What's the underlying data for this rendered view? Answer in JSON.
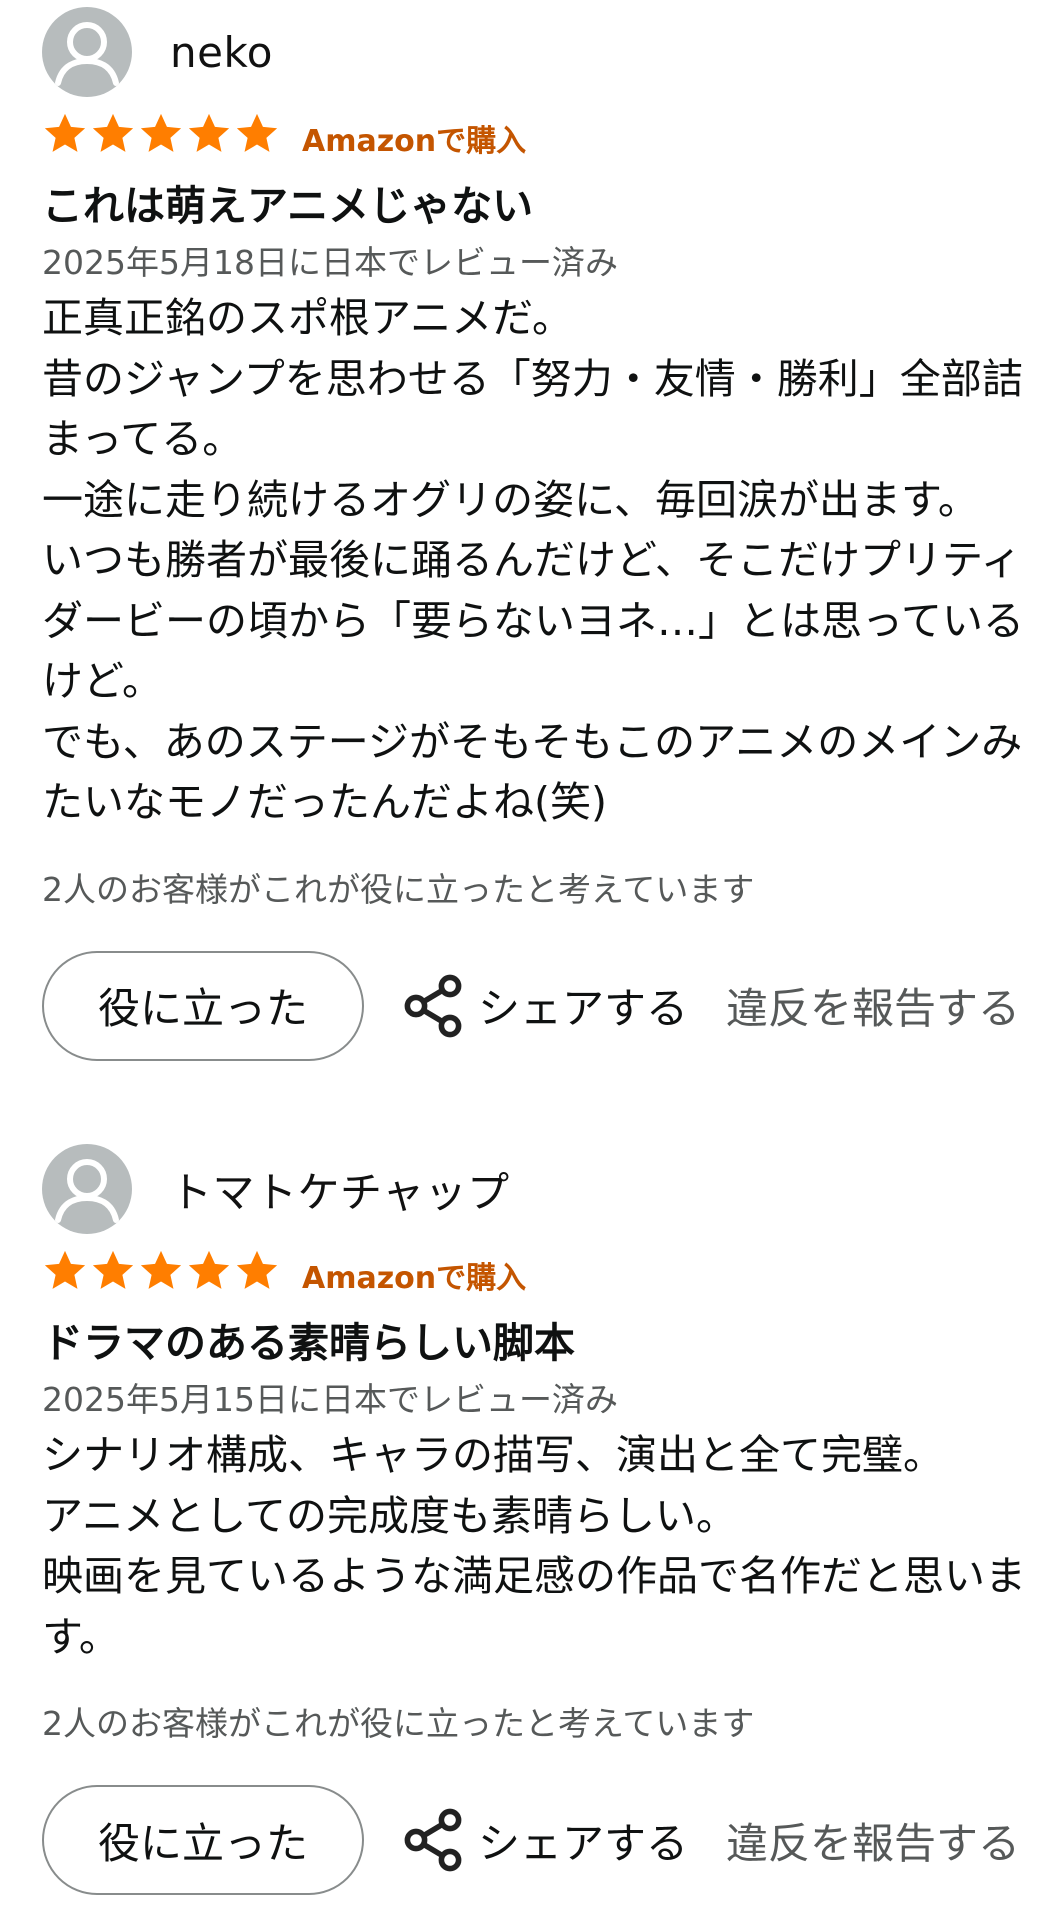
{
  "reviews": [
    {
      "author": "neko",
      "rating": 5,
      "verified": "Amazonで購入",
      "title": "これは萌えアニメじゃない",
      "date": "2025年5月18日に日本でレビュー済み",
      "body": "正真正銘のスポ根アニメだ。\n昔のジャンプを思わせる「努力・友情・勝利」全部詰まってる。\n一途に走り続けるオグリの姿に、毎回涙が出ます。\nいつも勝者が最後に踊るんだけど、そこだけプリティダービーの頃から「要らないヨネ…」とは思っているけど。\nでも、あのステージがそもそもこのアニメのメインみたいなモノだったんだよね(笑)",
      "helpful_count": "2人のお客様がこれが役に立ったと考えています",
      "helpful_label": "役に立った",
      "share_label": "シェアする",
      "report_label": "違反を報告する"
    },
    {
      "author": "トマトケチャップ",
      "rating": 5,
      "verified": "Amazonで購入",
      "title": "ドラマのある素晴らしい脚本",
      "date": "2025年5月15日に日本でレビュー済み",
      "body": "シナリオ構成、キャラの描写、演出と全て完璧。\nアニメとしての完成度も素晴らしい。\n映画を見ているような満足感の作品で名作だと思います。",
      "helpful_count": "2人のお客様がこれが役に立ったと考えています",
      "helpful_label": "役に立った",
      "share_label": "シェアする",
      "report_label": "違反を報告する"
    }
  ],
  "colors": {
    "star": "#ff7e00",
    "verified": "#c45500",
    "muted": "#565959",
    "avatar_bg": "#b7bcbd"
  },
  "icons": {
    "avatar": "default-user-avatar-icon",
    "star": "star-icon",
    "share": "share-icon"
  }
}
